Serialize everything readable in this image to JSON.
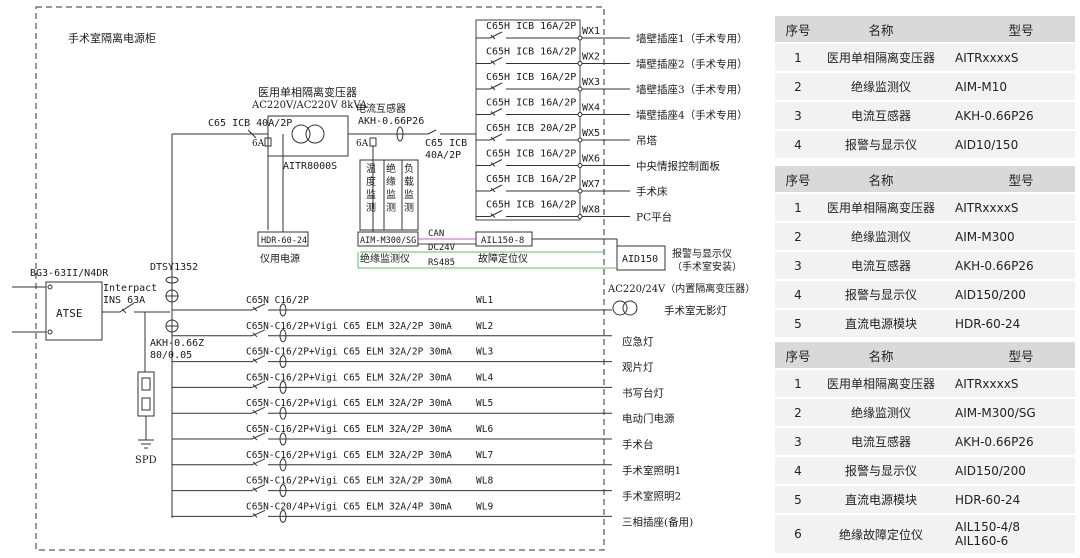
{
  "panel_title": "手术室隔离电源柜",
  "ats": {
    "model": "BG3-63II/N4DR",
    "label": "ATSE"
  },
  "spd": {
    "model": "DTSY1352",
    "label": "SPD"
  },
  "main_switch": {
    "name": "Interpact",
    "rating": "INS 63A"
  },
  "meter_ct": {
    "model": "AKH-0.66Z",
    "ratio": "80/0.05"
  },
  "isolation": {
    "input_breaker": "C65 ICB 40A/2P",
    "transformer_title": "医用单相隔离变压器",
    "transformer_spec": "AC220V/AC220V 8kVA",
    "transformer_model": "AITR8000S",
    "fuse_left": "6A",
    "fuse_right": "6A",
    "ct_title": "电流互感器",
    "ct_model": "AKH-0.66P26",
    "output_breaker_line1": "C65 ICB",
    "output_breaker_line2": "40A/2P",
    "power_module": "HDR-60-24",
    "power_module_label": "仪用电源",
    "monitor_model": "AIM-M300/SG",
    "monitor_label": "绝缘监测仪",
    "monitor_functions": [
      "温度监测",
      "绝缘监测",
      "负载监测"
    ],
    "locator_model": "AIL150-8",
    "locator_label": "故障定位仪",
    "comm": [
      "CAN",
      "DC24V",
      "RS485"
    ],
    "display_model": "AID150",
    "display_label_line1": "报警与显示仪",
    "display_label_line2": "（手术室安装）"
  },
  "it_circuits": [
    {
      "breaker": "C65H ICB 16A/2P",
      "id": "WX1",
      "load": "墙壁插座1（手术专用）"
    },
    {
      "breaker": "C65H ICB 16A/2P",
      "id": "WX2",
      "load": "墙壁插座2（手术专用）"
    },
    {
      "breaker": "C65H ICB 16A/2P",
      "id": "WX3",
      "load": "墙壁插座3（手术专用）"
    },
    {
      "breaker": "C65H ICB 16A/2P",
      "id": "WX4",
      "load": "墙壁插座4（手术专用）"
    },
    {
      "breaker": "C65H ICB 20A/2P",
      "id": "WX5",
      "load": "吊塔"
    },
    {
      "breaker": "C65H ICB 16A/2P",
      "id": "WX6",
      "load": "中央情报控制面板"
    },
    {
      "breaker": "C65H ICB 16A/2P",
      "id": "WX7",
      "load": "手术床"
    },
    {
      "breaker": "C65H ICB 16A/2P",
      "id": "WX8",
      "load": "PC平台"
    }
  ],
  "lamp_supply": "AC220/24V（内置隔离变压器）",
  "tn_circuits": [
    {
      "breaker": "C65N C16/2P",
      "id": "WL1",
      "load": "手术室无影灯"
    },
    {
      "breaker": "C65N-C16/2P+Vigi C65 ELM 32A/2P 30mA",
      "id": "WL2",
      "load": "应急灯"
    },
    {
      "breaker": "C65N-C16/2P+Vigi C65 ELM 32A/2P 30mA",
      "id": "WL3",
      "load": "观片灯"
    },
    {
      "breaker": "C65N-C16/2P+Vigi C65 ELM 32A/2P 30mA",
      "id": "WL4",
      "load": "书写台灯"
    },
    {
      "breaker": "C65N-C16/2P+Vigi C65 ELM 32A/2P 30mA",
      "id": "WL5",
      "load": "电动门电源"
    },
    {
      "breaker": "C65N-C16/2P+Vigi C65 ELM 32A/2P 30mA",
      "id": "WL6",
      "load": "手术台"
    },
    {
      "breaker": "C65N-C16/2P+Vigi C65 ELM 32A/2P 30mA",
      "id": "WL7",
      "load": "手术室照明1"
    },
    {
      "breaker": "C65N-C16/2P+Vigi C65 ELM 32A/2P 30mA",
      "id": "WL8",
      "load": "手术室照明2"
    },
    {
      "breaker": "C65N-C20/4P+Vigi C65 ELM 32A/4P 30mA",
      "id": "WL9",
      "load": "三相插座(备用)"
    }
  ],
  "tables": {
    "headers": {
      "no": "序号",
      "name": "名称",
      "model": "型号"
    },
    "table1": [
      {
        "no": "1",
        "name": "医用单相隔离变压器",
        "model": "AITRxxxxS"
      },
      {
        "no": "2",
        "name": "绝缘监测仪",
        "model": "AIM-M10"
      },
      {
        "no": "3",
        "name": "电流互感器",
        "model": "AKH-0.66P26"
      },
      {
        "no": "4",
        "name": "报警与显示仪",
        "model": "AID10/150"
      }
    ],
    "table2": [
      {
        "no": "1",
        "name": "医用单相隔离变压器",
        "model": "AITRxxxxS"
      },
      {
        "no": "2",
        "name": "绝缘监测仪",
        "model": "AIM-M300"
      },
      {
        "no": "3",
        "name": "电流互感器",
        "model": "AKH-0.66P26"
      },
      {
        "no": "4",
        "name": "报警与显示仪",
        "model": "AID150/200"
      },
      {
        "no": "5",
        "name": "直流电源模块",
        "model": "HDR-60-24"
      }
    ],
    "table3": [
      {
        "no": "1",
        "name": "医用单相隔离变压器",
        "model": "AITRxxxxS"
      },
      {
        "no": "2",
        "name": "绝缘监测仪",
        "model": "AIM-M300/SG"
      },
      {
        "no": "3",
        "name": "电流互感器",
        "model": "AKH-0.66P26"
      },
      {
        "no": "4",
        "name": "报警与显示仪",
        "model": "AID150/200"
      },
      {
        "no": "5",
        "name": "直流电源模块",
        "model": "HDR-60-24"
      },
      {
        "no": "6",
        "name": "绝缘故障定位仪",
        "model": "AIL150-4/8 AIL160-6"
      }
    ]
  }
}
